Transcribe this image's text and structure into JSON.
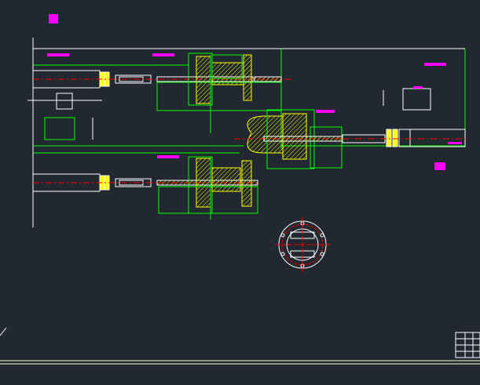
{
  "drawing": {
    "background": "#212830",
    "colors": {
      "outline": "#00ff00",
      "part": "#ffffff",
      "hatch": "#ffff00",
      "center_line": "#ff0000",
      "annotation": "#ff00ff",
      "dimension": "#00ff00",
      "title_block": "#ffffff",
      "border": "#ffffc8"
    },
    "labels": {
      "upper_left_label": "",
      "upper_right_label": "",
      "center_label": "",
      "lower_label": "",
      "right_side_label": ""
    },
    "components": [
      "drive-shaft-upper",
      "drive-shaft-lower",
      "drive-shaft-right",
      "flange-assembly",
      "bolt-circle-flange",
      "propeller-hub",
      "title-block"
    ]
  }
}
